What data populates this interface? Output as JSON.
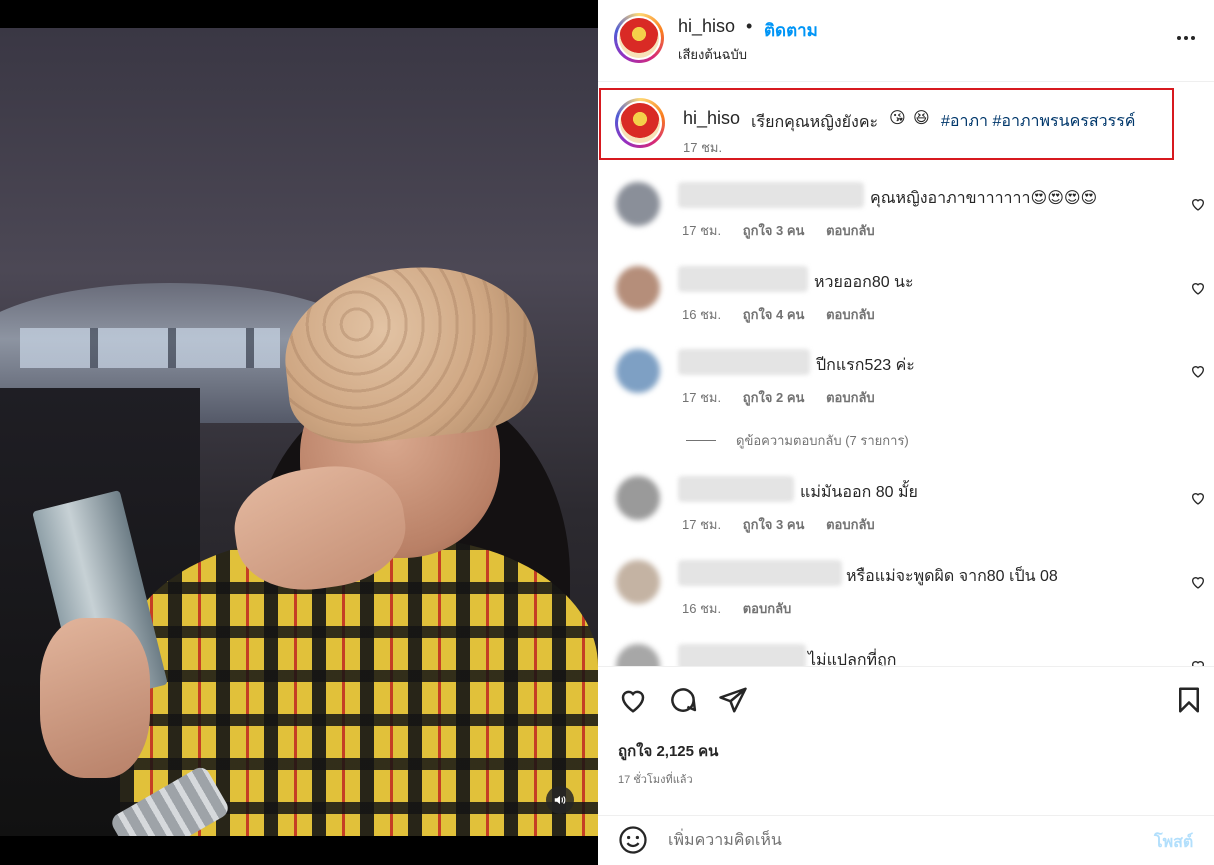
{
  "header": {
    "username": "hi_hiso",
    "separator": "•",
    "follow_label": "ติดตาม",
    "audio_label": "เสียงต้นฉบับ",
    "more_icon": "more-horizontal-icon"
  },
  "caption": {
    "username": "hi_hiso",
    "text": "เรียกคุณหญิงยังคะ",
    "emojis": [
      "😘",
      "😆"
    ],
    "hashtags": "#อาภา #อาภาพรนครสวรรค์",
    "time": "17 ชม."
  },
  "comments": [
    {
      "text": "คุณหญิงอาภาขาาาาาา😍😍😍😍",
      "time": "17 ชม.",
      "likes": "ถูกใจ 3 คน",
      "reply": "ตอบกลับ",
      "avatar_color": "#8a8f99"
    },
    {
      "text": "หวยออก80 นะ",
      "time": "16 ชม.",
      "likes": "ถูกใจ 4 คน",
      "reply": "ตอบกลับ",
      "avatar_color": "#b58e7a"
    },
    {
      "text": "ปีกแรก523 ค่ะ",
      "time": "17 ชม.",
      "likes": "ถูกใจ 2 คน",
      "reply": "ตอบกลับ",
      "avatar_color": "#7ea0c4"
    },
    {
      "text": "แม่มันออก 80 มั้ย",
      "time": "17 ชม.",
      "likes": "ถูกใจ 3 คน",
      "reply": "ตอบกลับ",
      "avatar_color": "#9a9a9a"
    },
    {
      "text": "หรือแม่จะพูดผิด จาก80 เป็น 08",
      "time": "16 ชม.",
      "likes": "",
      "reply": "ตอบกลับ",
      "avatar_color": "#c4b3a3"
    },
    {
      "text": "ไม่แปลกที่ถูก",
      "time": "",
      "likes": "",
      "reply": "",
      "avatar_color": "#a7a7a7"
    }
  ],
  "view_replies": "ดูข้อความตอบกลับ (7 รายการ)",
  "actions": {
    "like_icon": "heart-icon",
    "comment_icon": "comment-icon",
    "share_icon": "share-icon",
    "save_icon": "bookmark-icon",
    "likes_count": "ถูกใจ 2,125 คน",
    "posted_ago": "17 ชั่วโมงที่แล้ว"
  },
  "comment_input": {
    "placeholder": "เพิ่มความคิดเห็น",
    "post_label": "โพสต์",
    "emoji_icon": "emoji-icon"
  },
  "media": {
    "audio_icon": "speaker-icon"
  }
}
